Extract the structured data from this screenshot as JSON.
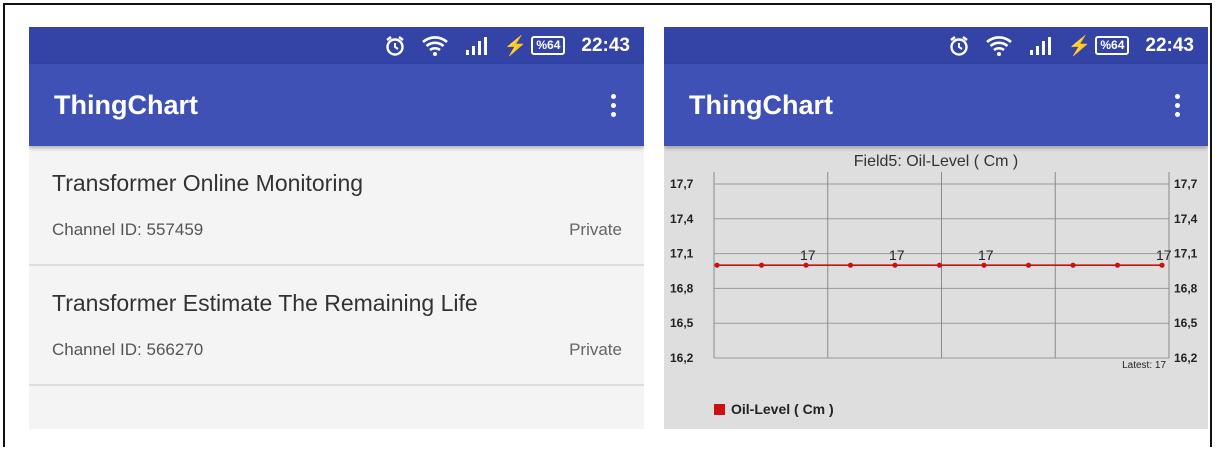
{
  "colors": {
    "statusbar": "#3344a6",
    "appbar": "#3f51b5",
    "series": "#cc1111",
    "chart_bg": "#dedede"
  },
  "left_screen": {
    "status": {
      "icons": [
        "alarm-icon",
        "wifi-icon",
        "signal-icon",
        "charging-icon"
      ],
      "battery": "%64",
      "time": "22:43"
    },
    "appbar": {
      "title": "ThingChart",
      "menu_icon": "more-vert-icon"
    },
    "channels": [
      {
        "name": "Transformer Online Monitoring",
        "channel_id": "Channel ID: 557459",
        "visibility": "Private"
      },
      {
        "name": "Transformer Estimate The Remaining Life",
        "channel_id": "Channel ID: 566270",
        "visibility": "Private"
      }
    ]
  },
  "right_screen": {
    "status": {
      "icons": [
        "alarm-icon",
        "wifi-icon",
        "signal-icon",
        "charging-icon"
      ],
      "battery": "%64",
      "time": "22:43"
    },
    "appbar": {
      "title": "ThingChart",
      "menu_icon": "more-vert-icon"
    }
  },
  "chart_data": {
    "type": "line",
    "title": "Field5: Oil-Level ( Cm )",
    "ylim": [
      16.2,
      17.7
    ],
    "y_ticks": [
      "17,7",
      "17,4",
      "17,1",
      "16,8",
      "16,5",
      "16,2"
    ],
    "y_tick_values": [
      17.7,
      17.4,
      17.1,
      16.8,
      16.5,
      16.2
    ],
    "grid": true,
    "series": [
      {
        "name": "Oil-Level ( Cm )",
        "values": [
          17,
          17,
          17,
          17,
          17,
          17,
          17,
          17,
          17,
          17,
          17
        ]
      }
    ],
    "point_labels": [
      "17",
      "17",
      "17",
      "17"
    ],
    "latest": "Latest: 17",
    "legend_position": "bottom-left"
  }
}
